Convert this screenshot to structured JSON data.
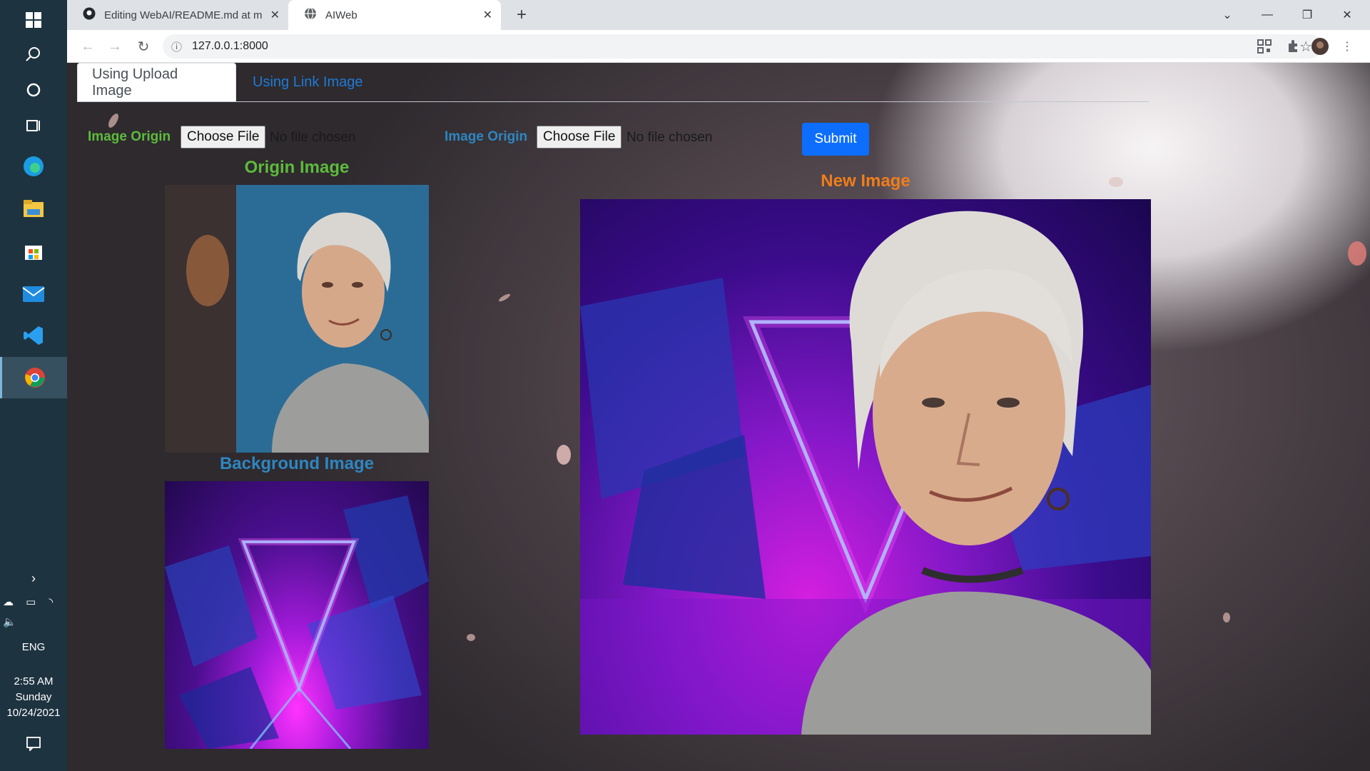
{
  "taskbar": {
    "icons": [
      "windows-start-icon",
      "search-icon",
      "cortana-icon",
      "task-view-icon",
      "edge-icon",
      "file-explorer-icon",
      "store-icon",
      "mail-icon",
      "vscode-icon",
      "chrome-icon"
    ],
    "language": "ENG",
    "time": "2:55 AM",
    "day": "Sunday",
    "date": "10/24/2021"
  },
  "browser": {
    "tabs": [
      {
        "title": "Editing WebAI/README.md at m",
        "icon": "github-icon"
      },
      {
        "title": "AIWeb",
        "icon": "globe-icon"
      }
    ],
    "url": "127.0.0.1:8000"
  },
  "page": {
    "nav_tabs": [
      "Using Upload Image",
      "Using Link Image"
    ],
    "form": {
      "origin_label": "Image Origin",
      "background_label": "Image Origin",
      "choose_file_label": "Choose File",
      "no_file_text": "No file chosen",
      "submit_label": "Submit"
    },
    "titles": {
      "origin": "Origin Image",
      "background": "Background Image",
      "new": "New Image"
    },
    "colors": {
      "origin_title": "#5dbb3c",
      "background_title": "#2e86c1",
      "new_title": "#f07d1a",
      "submit": "#0d6efd"
    }
  }
}
